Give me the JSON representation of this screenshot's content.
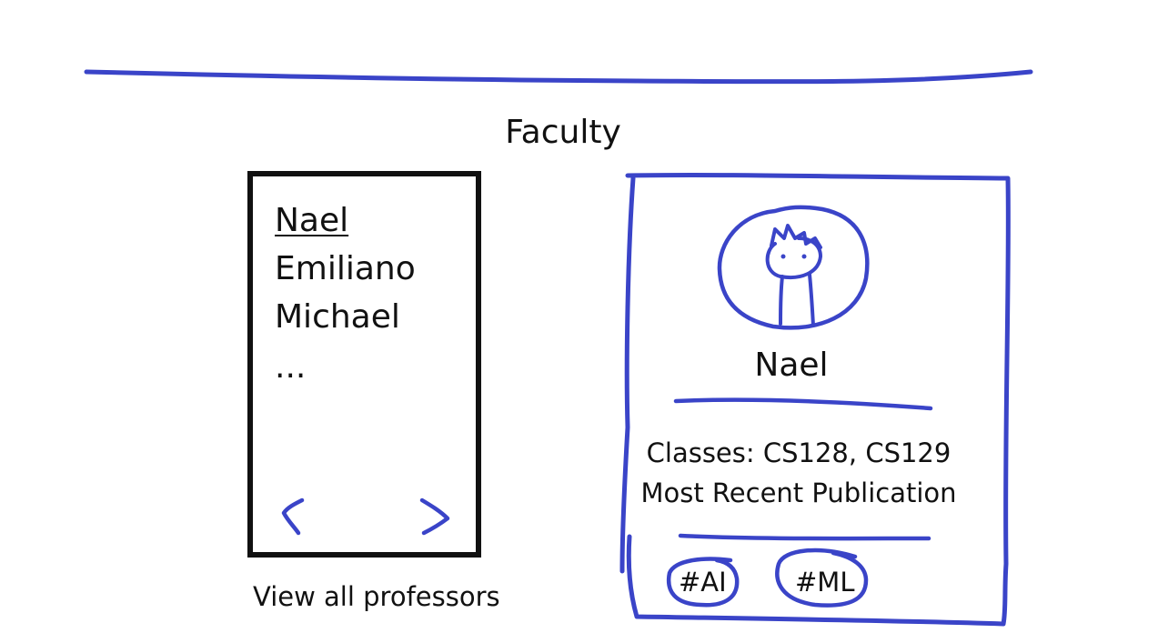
{
  "header": {
    "title": "Faculty"
  },
  "professor_list": {
    "items": [
      {
        "name": "Nael",
        "selected": true
      },
      {
        "name": "Emiliano",
        "selected": false
      },
      {
        "name": "Michael",
        "selected": false
      }
    ],
    "more_indicator": "...",
    "prev_icon": "chevron-left-icon",
    "next_icon": "chevron-right-icon",
    "view_all_label": "View all professors"
  },
  "profile_card": {
    "avatar_icon": "llama-doodle-icon",
    "name": "Nael",
    "classes_line": "Classes: CS128, CS129",
    "publication_line": "Most Recent Publication",
    "tags": [
      "#AI",
      "#ML"
    ]
  },
  "colors": {
    "sketch_blue": "#3a44c8",
    "list_border": "#111111",
    "text": "#111111",
    "background": "#ffffff"
  }
}
